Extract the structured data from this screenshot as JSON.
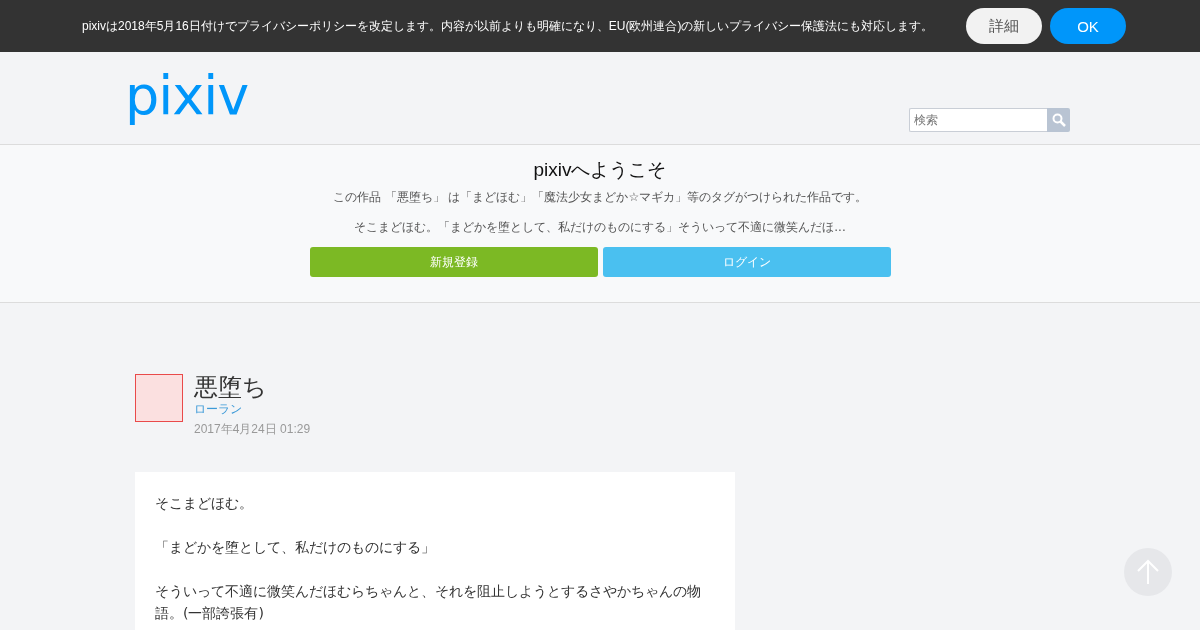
{
  "notice_bar": {
    "message": "pixivは2018年5月16日付けでプライバシーポリシーを改定します。内容が以前よりも明確になり、EU(欧州連合)の新しいプライバシー保護法にも対応します。",
    "buttons": [
      {
        "label": "詳細",
        "kind": "secondary"
      },
      {
        "label": "OK",
        "kind": "primary"
      }
    ]
  },
  "header": {
    "logo": "pixiv",
    "search": {
      "placeholder": "検索"
    }
  },
  "welcome": {
    "title": "pixivへようこそ",
    "description": "この作品 「悪堕ち」 は「まどほむ」「魔法少女まどか☆マギカ」等のタグがつけられた作品です。",
    "excerpt": "そこまどほむ。「まどかを堕として、私だけのものにする」そういって不適に微笑んだほ...",
    "buttons": [
      {
        "label": "新規登録",
        "kind": "signup"
      },
      {
        "label": "ログイン",
        "kind": "login"
      }
    ]
  },
  "work": {
    "title": "悪堕ち",
    "author": "ローラン",
    "date": "2017年4月24日 01:29",
    "caption": [
      "そこまどほむ。",
      "「まどかを堕として、私だけのものにする」",
      "そういって不適に微笑んだほむらちゃんと、それを阻止しようとするさやかちゃんの物語。(一部誇張有)"
    ]
  }
}
